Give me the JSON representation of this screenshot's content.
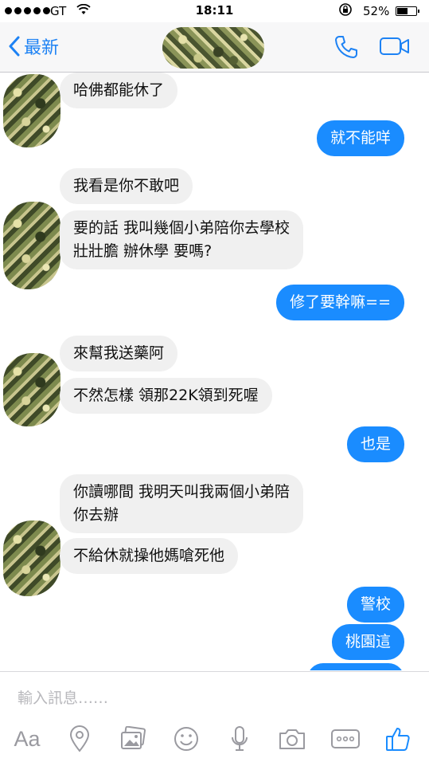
{
  "status_bar": {
    "carrier": "GT",
    "time": "18:11",
    "battery": "52%",
    "battery_level": 0.52
  },
  "header": {
    "back_label": "最新"
  },
  "messages": [
    {
      "side": "in",
      "text": "哈佛都能休了"
    },
    {
      "side": "out",
      "text": "就不能咩"
    },
    {
      "side": "in",
      "text": "我看是你不敢吧"
    },
    {
      "side": "in",
      "text": "要的話 我叫幾個小弟陪你去學校\n壯壯膽 辦休學 要嗎?"
    },
    {
      "side": "out",
      "text": "修了要幹嘛=="
    },
    {
      "side": "in",
      "text": "來幫我送藥阿"
    },
    {
      "side": "in",
      "text": "不然怎樣 領那22K領到死喔"
    },
    {
      "side": "out",
      "text": "也是"
    },
    {
      "side": "in",
      "text": "你讀哪間 我明天叫我兩個小弟陪\n你去辦"
    },
    {
      "side": "in",
      "text": "不給休就操他媽嗆死他"
    },
    {
      "side": "out",
      "text": "警校"
    },
    {
      "side": "out",
      "text": "桃園這"
    }
  ],
  "composer": {
    "placeholder": "輸入訊息……",
    "aa_label": "Aa"
  },
  "icons": {
    "call": "phone-icon",
    "video": "video-camera-icon",
    "location": "location-pin-icon",
    "photos": "photos-icon",
    "sticker": "smiley-icon",
    "voice": "microphone-icon",
    "camera": "camera-icon",
    "more": "more-icon",
    "like": "thumbs-up-icon"
  },
  "colors": {
    "accent": "#1a8cff",
    "incoming_bubble": "#f0f0f0",
    "link": "#1d82f4"
  }
}
